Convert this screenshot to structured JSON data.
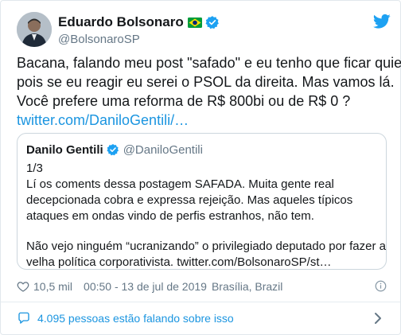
{
  "author": {
    "display_name": "Eduardo Bolsonaro",
    "handle": "@BolsonaroSP"
  },
  "tweet": {
    "lines": [
      "Bacana, falando meu post \"safado\" e eu tenho que ficar quieto,",
      "pois se eu reagir eu serei o PSOL da direita. Mas vamos lá.",
      "Você prefere uma reforma de R$ 800bi ou de R$ 0 ?"
    ],
    "link": "twitter.com/DaniloGentili/…"
  },
  "quoted_tweet": {
    "display_name": "Danilo Gentili",
    "handle": "@DaniloGentili",
    "paragraph1": [
      "1/3",
      "Lí os coments dessa postagem SAFADA. Muita gente real",
      "decepcionada cobra e expressa rejeição. Mas aqueles típicos",
      "ataques em ondas vindo de perfis estranhos, não tem."
    ],
    "paragraph2": [
      "Não vejo ninguém “ucranizando” o privilegiado deputado por fazer a",
      "velha política corporativista. twitter.com/BolsonaroSP/st…"
    ]
  },
  "meta": {
    "likes": "10,5 mil",
    "timestamp": "00:50 - 13 de jul de 2019",
    "location": "Brasília, Brazil"
  },
  "conversation": {
    "label": "4.095 pessoas estão falando sobre isso"
  },
  "icons": {
    "avatar": "avatar",
    "flag": "brazil-flag-icon",
    "verified": "verified-badge-icon",
    "brand": "twitter-bird-icon",
    "like": "heart-icon",
    "info": "info-icon",
    "conversation": "speech-bubble-icon",
    "navigate": "chevron-right-icon"
  },
  "colors": {
    "accent": "#1da1f2",
    "link": "#1b95e0",
    "muted": "#657786",
    "text": "#14171a",
    "border": "#e1e8ed"
  }
}
